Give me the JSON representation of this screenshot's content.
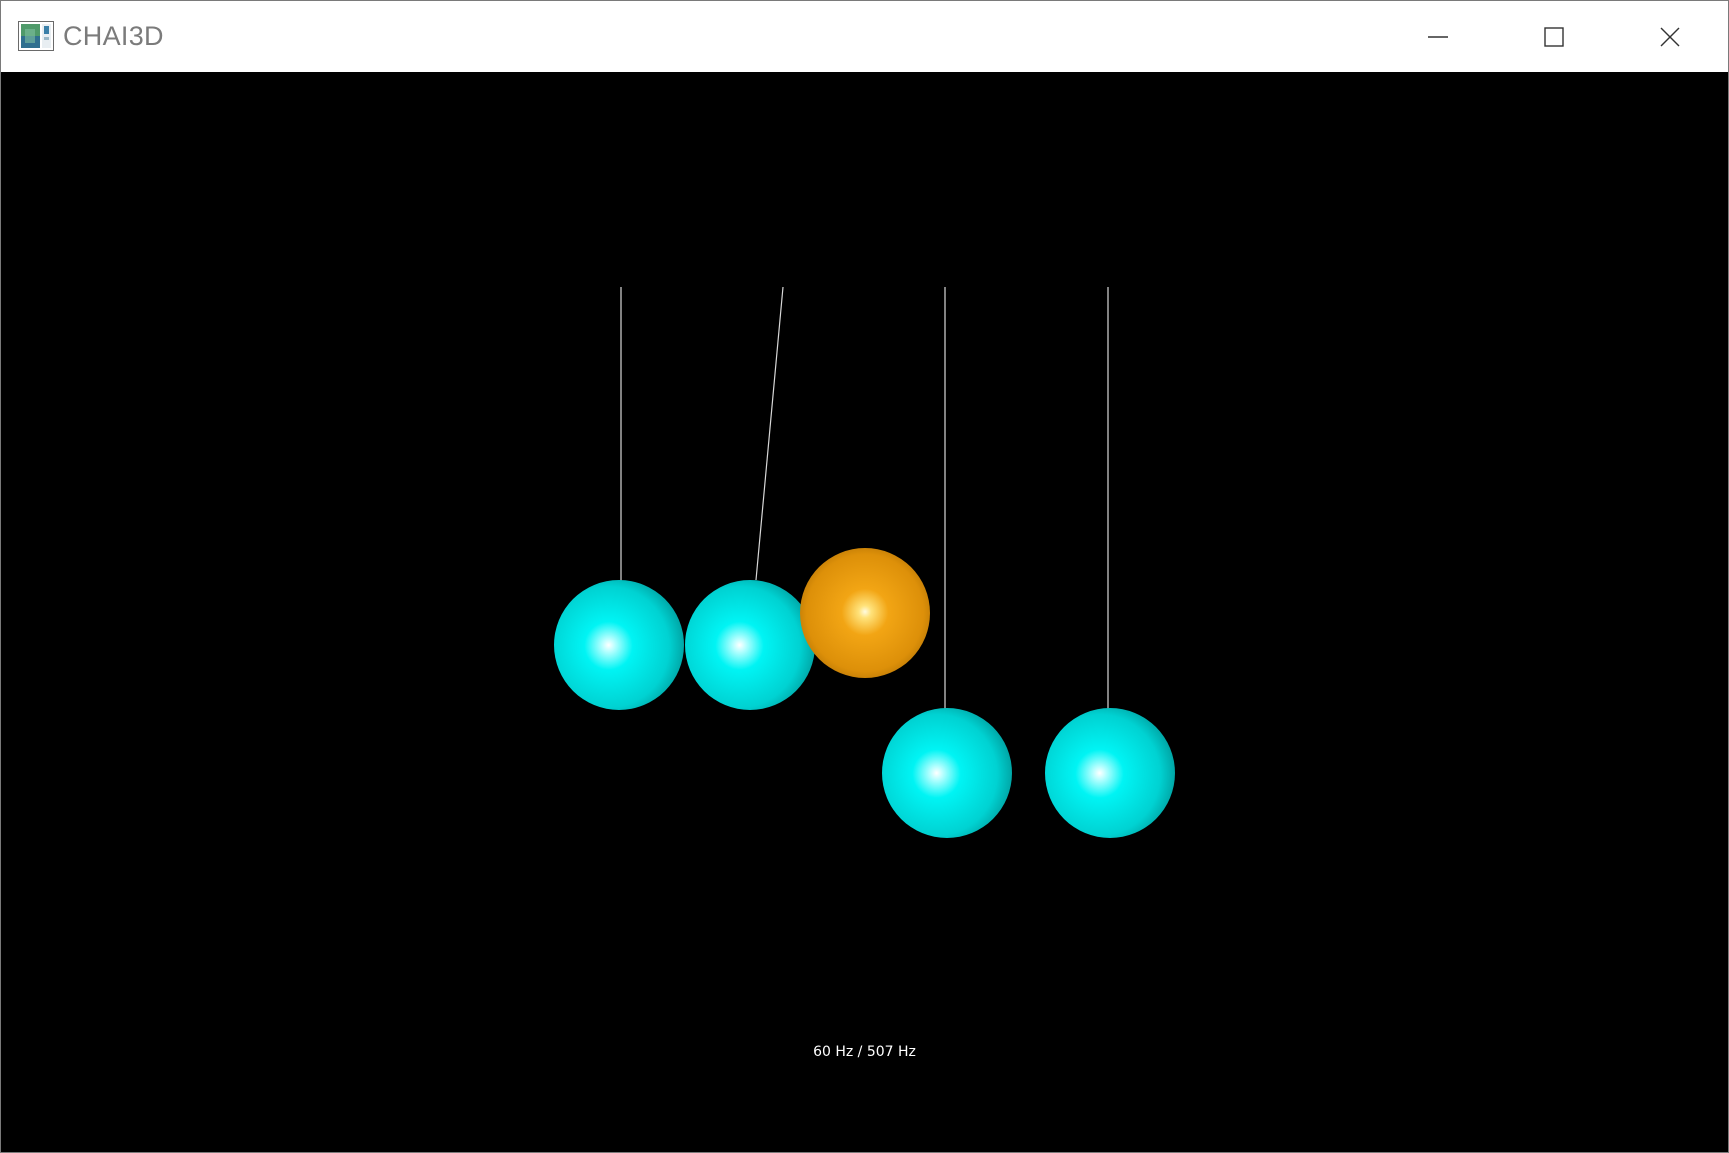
{
  "window": {
    "title": "CHAI3D",
    "icon": "chai3d-app-icon",
    "controls": {
      "minimize_icon": "minimize-icon",
      "maximize_icon": "maximize-icon",
      "close_icon": "close-icon"
    }
  },
  "scene": {
    "background_color": "#000000",
    "string_color": "#d8d8d8",
    "ball_colors": {
      "cyan": "#00e5e5",
      "orange": "#e89a0c"
    },
    "balls": [
      {
        "id": "ball-1",
        "color": "cyan"
      },
      {
        "id": "ball-2",
        "color": "cyan"
      },
      {
        "id": "ball-3",
        "color": "orange"
      },
      {
        "id": "ball-4",
        "color": "cyan"
      },
      {
        "id": "ball-5",
        "color": "cyan"
      }
    ]
  },
  "status": {
    "rates": "60 Hz / 507 Hz"
  }
}
